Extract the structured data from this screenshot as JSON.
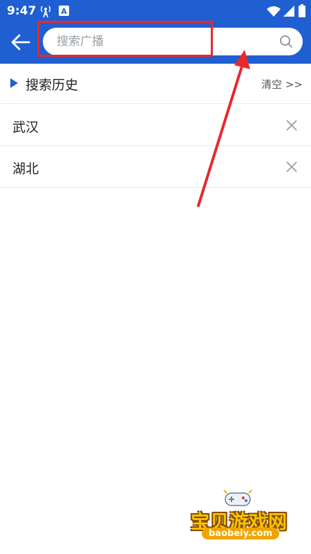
{
  "status_bar": {
    "time": "9:47",
    "icons": [
      "hotspot-icon",
      "keyboard-a-icon",
      "wifi-icon",
      "signal-icon",
      "battery-icon"
    ],
    "keyboard_badge": "A"
  },
  "header": {
    "background_color": "#1f5fd1",
    "back_icon": "back-arrow-icon",
    "search": {
      "placeholder": "搜索广播",
      "value": "",
      "icon": "search-icon"
    }
  },
  "annotation": {
    "highlight_color": "#e8282b",
    "arrow_color": "#e8282b"
  },
  "history": {
    "title": "搜索历史",
    "clear_label": "清空 >>",
    "items": [
      {
        "label": "武汉",
        "delete_icon": "close-icon"
      },
      {
        "label": "湖北",
        "delete_icon": "close-icon"
      }
    ]
  },
  "watermark": {
    "main": "宝贝游戏网",
    "sub": "baobeiy.com"
  }
}
